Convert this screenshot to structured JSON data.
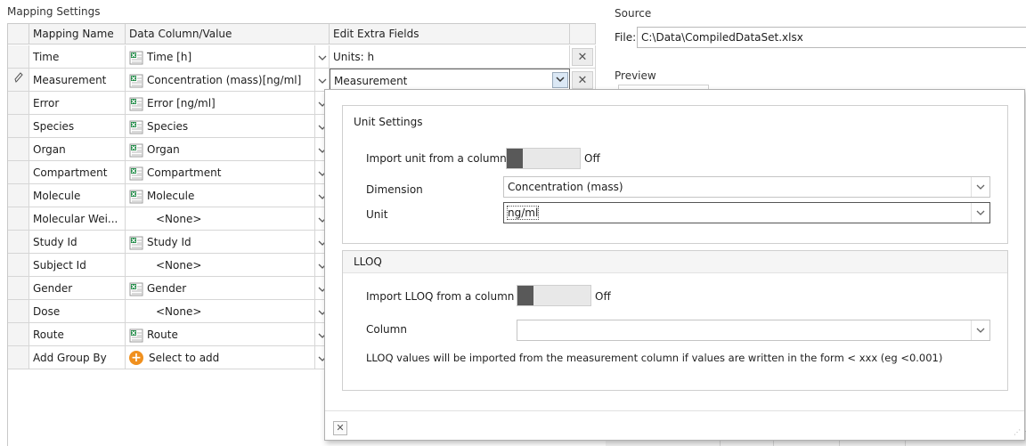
{
  "mapping": {
    "title": "Mapping Settings",
    "headers": {
      "name": "Mapping Name",
      "column": "Data Column/Value",
      "extra": "Edit Extra Fields"
    },
    "rows": [
      {
        "name": "Time",
        "value": "Time [h]",
        "icon": "excel-column-icon",
        "extra": "Units: h",
        "delete": "✕"
      },
      {
        "name": "Measurement",
        "value": "Concentration (mass)[ng/ml]",
        "icon": "excel-column-icon",
        "extra": "Measurement",
        "delete": "✕",
        "edit_icon": "pencil-icon"
      },
      {
        "name": "Error",
        "value": "Error [ng/ml]",
        "icon": "excel-column-icon"
      },
      {
        "name": "Species",
        "value": "Species",
        "icon": "excel-column-icon"
      },
      {
        "name": "Organ",
        "value": "Organ",
        "icon": "excel-column-icon"
      },
      {
        "name": "Compartment",
        "value": "Compartment",
        "icon": "excel-column-icon"
      },
      {
        "name": "Molecule",
        "value": "Molecule",
        "icon": "excel-column-icon"
      },
      {
        "name": "Molecular Wei...",
        "value": "<None>"
      },
      {
        "name": "Study Id",
        "value": "Study Id",
        "icon": "excel-column-icon"
      },
      {
        "name": "Subject Id",
        "value": "<None>"
      },
      {
        "name": "Gender",
        "value": "Gender",
        "icon": "excel-column-icon"
      },
      {
        "name": "Dose",
        "value": "<None>"
      },
      {
        "name": "Route",
        "value": "Route",
        "icon": "excel-column-icon"
      },
      {
        "name": "Add Group By",
        "value": "Select to add",
        "icon": "plus-icon"
      }
    ]
  },
  "source": {
    "title": "Source",
    "file_label": "File:",
    "file_path": "C:\\Data\\CompiledDataSet.xlsx",
    "preview_label": "Preview"
  },
  "popup": {
    "unit_settings": {
      "title": "Unit Settings",
      "import_label": "Import unit from a column",
      "toggle_state": "Off",
      "dimension_label": "Dimension",
      "dimension_value": "Concentration (mass)",
      "unit_label": "Unit",
      "unit_value": "ng/ml"
    },
    "lloq": {
      "title": "LLOQ",
      "import_label": "Import LLOQ from a column",
      "toggle_state": "Off",
      "column_label": "Column",
      "column_value": "",
      "note": "LLOQ values will be imported from the measurement column if values are written in the form < xxx (eg <0.001)"
    },
    "close_glyph": "✕"
  },
  "colors": {
    "excel_green": "#1f8a46",
    "accent_orange": "#f0901e",
    "toggle_knob": "#595959"
  }
}
